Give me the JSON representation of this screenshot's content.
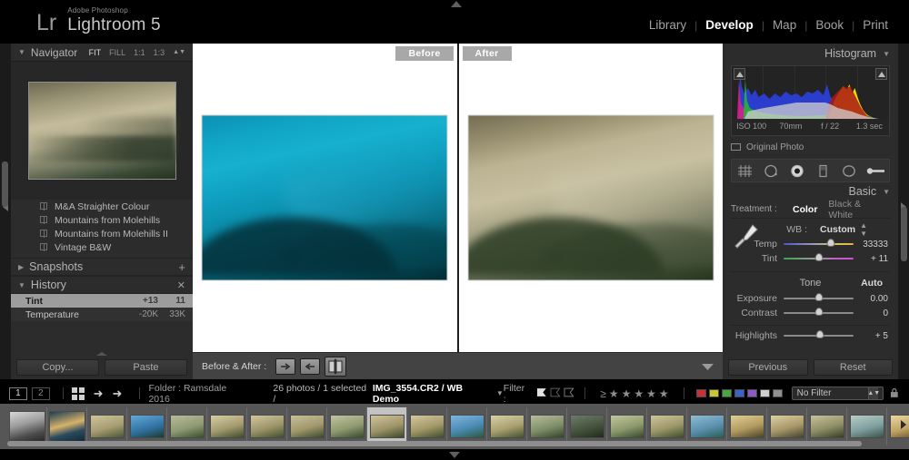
{
  "app": {
    "brand_mark": "Lr",
    "brand_sub": "Adobe Photoshop",
    "brand_name": "Lightroom 5",
    "accent_selected": "#ffffff"
  },
  "modules": [
    {
      "label": "Library",
      "active": false
    },
    {
      "label": "Develop",
      "active": true
    },
    {
      "label": "Map",
      "active": false
    },
    {
      "label": "Book",
      "active": false
    },
    {
      "label": "Print",
      "active": false
    }
  ],
  "left_panel": {
    "navigator": {
      "title": "Navigator",
      "modes": [
        "FIT",
        "FILL",
        "1:1",
        "1:3"
      ],
      "selected_mode": "FIT"
    },
    "presets": [
      {
        "label": "M&A Straighter Colour"
      },
      {
        "label": "Mountains from Molehills"
      },
      {
        "label": "Mountains from Molehills II"
      },
      {
        "label": "Vintage B&W"
      }
    ],
    "snapshots": {
      "title": "Snapshots",
      "add_label": "+"
    },
    "history": {
      "title": "History",
      "clear_label": "✕",
      "rows": [
        {
          "name": "Tint",
          "delta": "+13",
          "value": "11",
          "selected": true
        },
        {
          "name": "Temperature",
          "delta": "-20K",
          "value": "33K",
          "selected": false
        }
      ]
    },
    "copy_label": "Copy...",
    "paste_label": "Paste"
  },
  "center": {
    "before_label": "Before",
    "after_label": "After",
    "toolbar": {
      "title": "Before & After :",
      "buttons": [
        "copy-settings-right-icon",
        "copy-settings-left-icon",
        "swap-before-after-icon"
      ],
      "caret": "toolbar-caret-icon"
    }
  },
  "right_panel": {
    "histogram": {
      "title": "Histogram",
      "iso": "ISO 100",
      "focal": "70mm",
      "aperture": "f / 22",
      "shutter": "1.3 sec",
      "original_photo_label": "Original Photo"
    },
    "tools": [
      "crop-overlay-icon",
      "spot-removal-icon",
      "red-eye-correction-icon",
      "graduated-filter-icon",
      "radial-filter-icon",
      "adjustment-brush-icon"
    ],
    "basic": {
      "title": "Basic",
      "treatment_label": "Treatment :",
      "treatment_options": [
        {
          "label": "Color",
          "active": true
        },
        {
          "label": "Black & White",
          "active": false
        }
      ],
      "wb_label": "WB :",
      "wb_value": "Custom",
      "sliders": [
        {
          "name": "Temp",
          "value": "33333",
          "pos": 68,
          "track": "temp"
        },
        {
          "name": "Tint",
          "value": "+ 11",
          "pos": 50,
          "track": "tint"
        }
      ],
      "tone_label": "Tone",
      "auto_label": "Auto",
      "tone_sliders": [
        {
          "name": "Exposure",
          "value": "0.00",
          "pos": 50,
          "track": "plain"
        },
        {
          "name": "Contrast",
          "value": "0",
          "pos": 50,
          "track": "plain"
        }
      ],
      "presence_sliders": [
        {
          "name": "Highlights",
          "value": "+ 5",
          "pos": 52,
          "track": "plain"
        }
      ]
    },
    "previous_label": "Previous",
    "reset_label": "Reset"
  },
  "statusbar": {
    "view_buttons": [
      "1",
      "2"
    ],
    "grid_icon": "grid-view-icon",
    "prev_icon": "previous-photo-icon",
    "next_icon": "next-photo-icon",
    "folder_text": "Folder : Ramsdale 2016",
    "count_text": "26 photos / 1 selected /",
    "file_text": "IMG_3554.CR2 / WB Demo",
    "filter_label": "Filter :",
    "star_count": 5,
    "star_glyph": "★",
    "gte_glyph": "≥",
    "color_labels": [
      "#c8303a",
      "#c9c832",
      "#46a844",
      "#3b62c9",
      "#8a5ac7",
      "#cfcfcf",
      "#8f8f8f"
    ],
    "no_filter_label": "No Filter"
  },
  "filmstrip": {
    "thumbnails": [
      {
        "tone": "mono"
      },
      {
        "tone": "teal-warm"
      },
      {
        "tone": "warm1"
      },
      {
        "tone": "blue1"
      },
      {
        "tone": "olive1"
      },
      {
        "tone": "warm2"
      },
      {
        "tone": "warm3"
      },
      {
        "tone": "warm4"
      },
      {
        "tone": "olive2"
      },
      {
        "tone": "warm5",
        "selected": true
      },
      {
        "tone": "warm6"
      },
      {
        "tone": "blue2"
      },
      {
        "tone": "warm7"
      },
      {
        "tone": "olive3"
      },
      {
        "tone": "dark1"
      },
      {
        "tone": "olive4"
      },
      {
        "tone": "warm8"
      },
      {
        "tone": "blue3"
      },
      {
        "tone": "warm9"
      },
      {
        "tone": "warm10"
      },
      {
        "tone": "olive5"
      },
      {
        "tone": "blue4"
      },
      {
        "tone": "warm11"
      },
      {
        "tone": "teal2"
      },
      {
        "tone": "mono2"
      },
      {
        "tone": "dark2"
      }
    ]
  }
}
